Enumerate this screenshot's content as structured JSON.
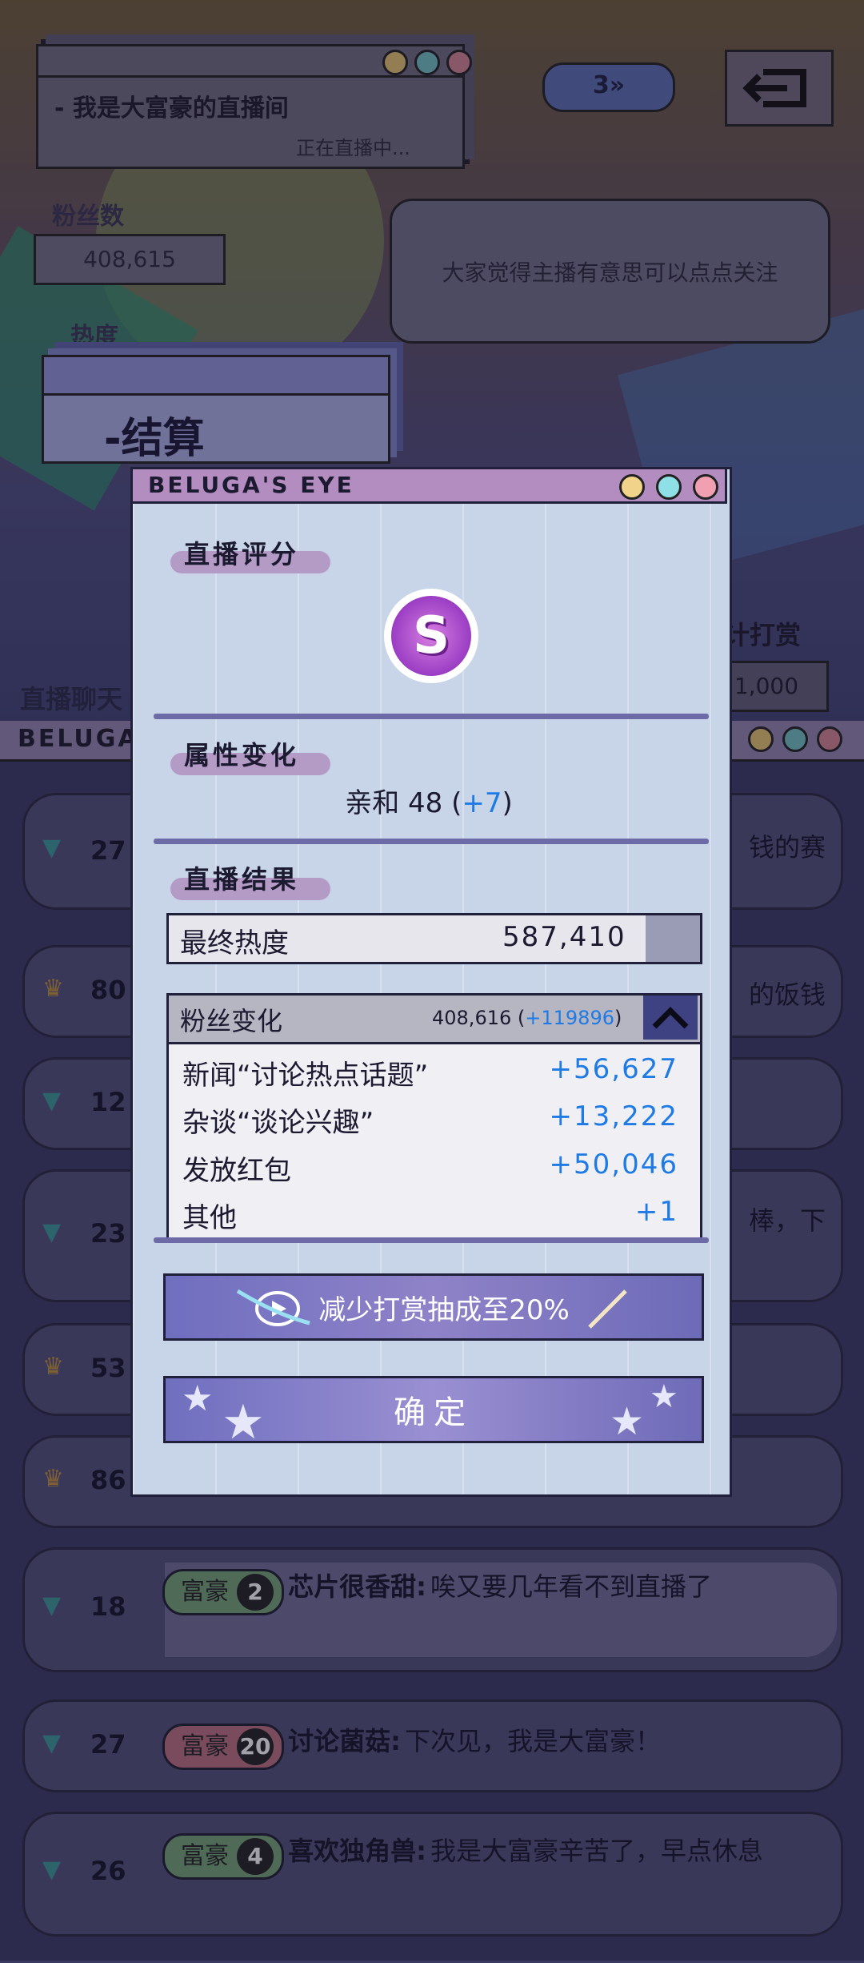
{
  "stream": {
    "title": "- 我是大富豪的直播间",
    "status": "正在直播中...",
    "level_badge": "3»",
    "fans_label": "粉丝数",
    "fans_value": "408,615",
    "heat_label": "热度",
    "bubble_text": "大家觉得主播有意思可以点点关注",
    "tip_label": "计打赏",
    "tip_value": "1,000",
    "chat_label": "直播聊天",
    "chat_window_title": "BELUGA'S EYE"
  },
  "settle_card": {
    "title": "-结算"
  },
  "chat_rows": [
    {
      "num": "27",
      "right": "钱的赛"
    },
    {
      "num": "80",
      "right": "的饭钱"
    },
    {
      "num": "12",
      "right": ""
    },
    {
      "num": "23",
      "right": "棒，下"
    },
    {
      "num": "53",
      "right": ""
    },
    {
      "num": "86",
      "right": ""
    },
    {
      "num": "18",
      "badge": "富豪",
      "level": "2",
      "user": "芯片很香甜:",
      "text": "唉又要几年看不到直播了"
    },
    {
      "num": "27",
      "badge": "富豪",
      "level": "20",
      "user": "讨论菌菇:",
      "text": "下次见，我是大富豪！"
    },
    {
      "num": "26",
      "badge": "富豪",
      "level": "4",
      "user": "喜欢独角兽:",
      "text": "我是大富豪辛苦了，早点休息"
    }
  ],
  "dialog": {
    "window_title": "BELUGA'S EYE",
    "rating_title": "直播评分",
    "grade": "S",
    "attr_title": "属性变化",
    "attr_name": "亲和",
    "attr_value": "48",
    "attr_delta": "+7",
    "result_title": "直播结果",
    "final_heat_label": "最终热度",
    "final_heat_value": "587,410",
    "fans_change_label": "粉丝变化",
    "fans_change_total": "408,616",
    "fans_change_delta": "+119896",
    "sources": [
      {
        "label": "新闻“讨论热点话题”",
        "value": "+56,627"
      },
      {
        "label": "杂谈“谈论兴趣”",
        "value": "+13,222"
      },
      {
        "label": "发放红包",
        "value": "+50,046"
      },
      {
        "label": "其他",
        "value": "+1"
      }
    ],
    "perk_label": "减少打赏抽成至20%",
    "confirm_label": "确定"
  },
  "colors": {
    "accent_blue": "#1e7be6",
    "dialog_bg": "#c8d5e8",
    "titlebar": "#b48dc0",
    "button": "#7f78c8"
  }
}
